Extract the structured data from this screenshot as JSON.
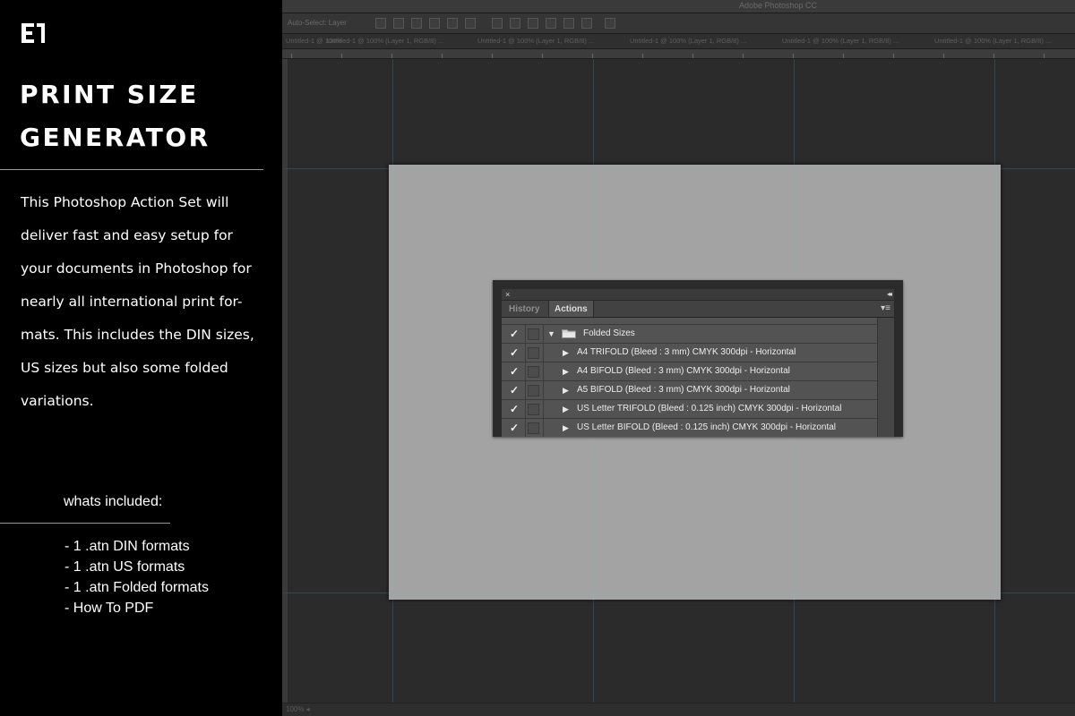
{
  "promo": {
    "logo_icon": "e-bracket-logo",
    "title_line1": "PRINT SIZE",
    "title_line2": "GENERATOR",
    "description_lines": [
      "This Photoshop Action Set will",
      "deliver fast and easy setup for",
      "your documents in Photoshop for",
      "nearly all international print for-",
      "mats. This includes the DIN sizes,",
      "US sizes but also some folded",
      "variations."
    ],
    "included_heading": "whats included:",
    "included_items": [
      "- 1 .atn DIN formats",
      "- 1 .atn US formats",
      "- 1 .atn Folded formats",
      "- How To PDF"
    ]
  },
  "photoshop": {
    "window_title": "Adobe Photoshop CC",
    "options_label": "Auto-Select: Layer",
    "tabs": [
      "Untitled-1 @ 100% ...",
      "Untitled-1 @ 100% (Layer 1, RGB/8) ...",
      "Untitled-1 @ 100% (Layer 1, RGB/8) ...",
      "Untitled-1 @ 100% (Layer 1, RGB/8) ...",
      "Untitled-1 @ 100% (Layer 1, RGB/8) ...",
      "Untitled-1 @ 100% (Layer 1, RGB/8) ..."
    ],
    "status_text": "100% ◂",
    "colors": {
      "canvas": "#a3a3a3",
      "guides": "#2f4b4e",
      "workspace": "#2b2b2b"
    }
  },
  "actions_panel": {
    "close_icon": "×",
    "collapse_icon": "◂◂",
    "menu_icon": "▾≡",
    "tabs": [
      {
        "label": "History",
        "active": false
      },
      {
        "label": "Actions",
        "active": true
      }
    ],
    "folder": {
      "name": "Folded Sizes",
      "expanded": true,
      "checked": true
    },
    "actions": [
      {
        "name": "A4 TRIFOLD (Bleed : 3 mm) CMYK 300dpi - Horizontal",
        "checked": true
      },
      {
        "name": "A4 BIFOLD (Bleed : 3 mm) CMYK 300dpi - Horizontal",
        "checked": true
      },
      {
        "name": "A5 BIFOLD (Bleed : 3 mm) CMYK 300dpi - Horizontal",
        "checked": true
      },
      {
        "name": "US Letter TRIFOLD (Bleed : 0.125 inch) CMYK 300dpi - Horizontal",
        "checked": true
      },
      {
        "name": "US Letter BIFOLD (Bleed : 0.125 inch) CMYK 300dpi - Horizontal",
        "checked": true
      }
    ]
  }
}
